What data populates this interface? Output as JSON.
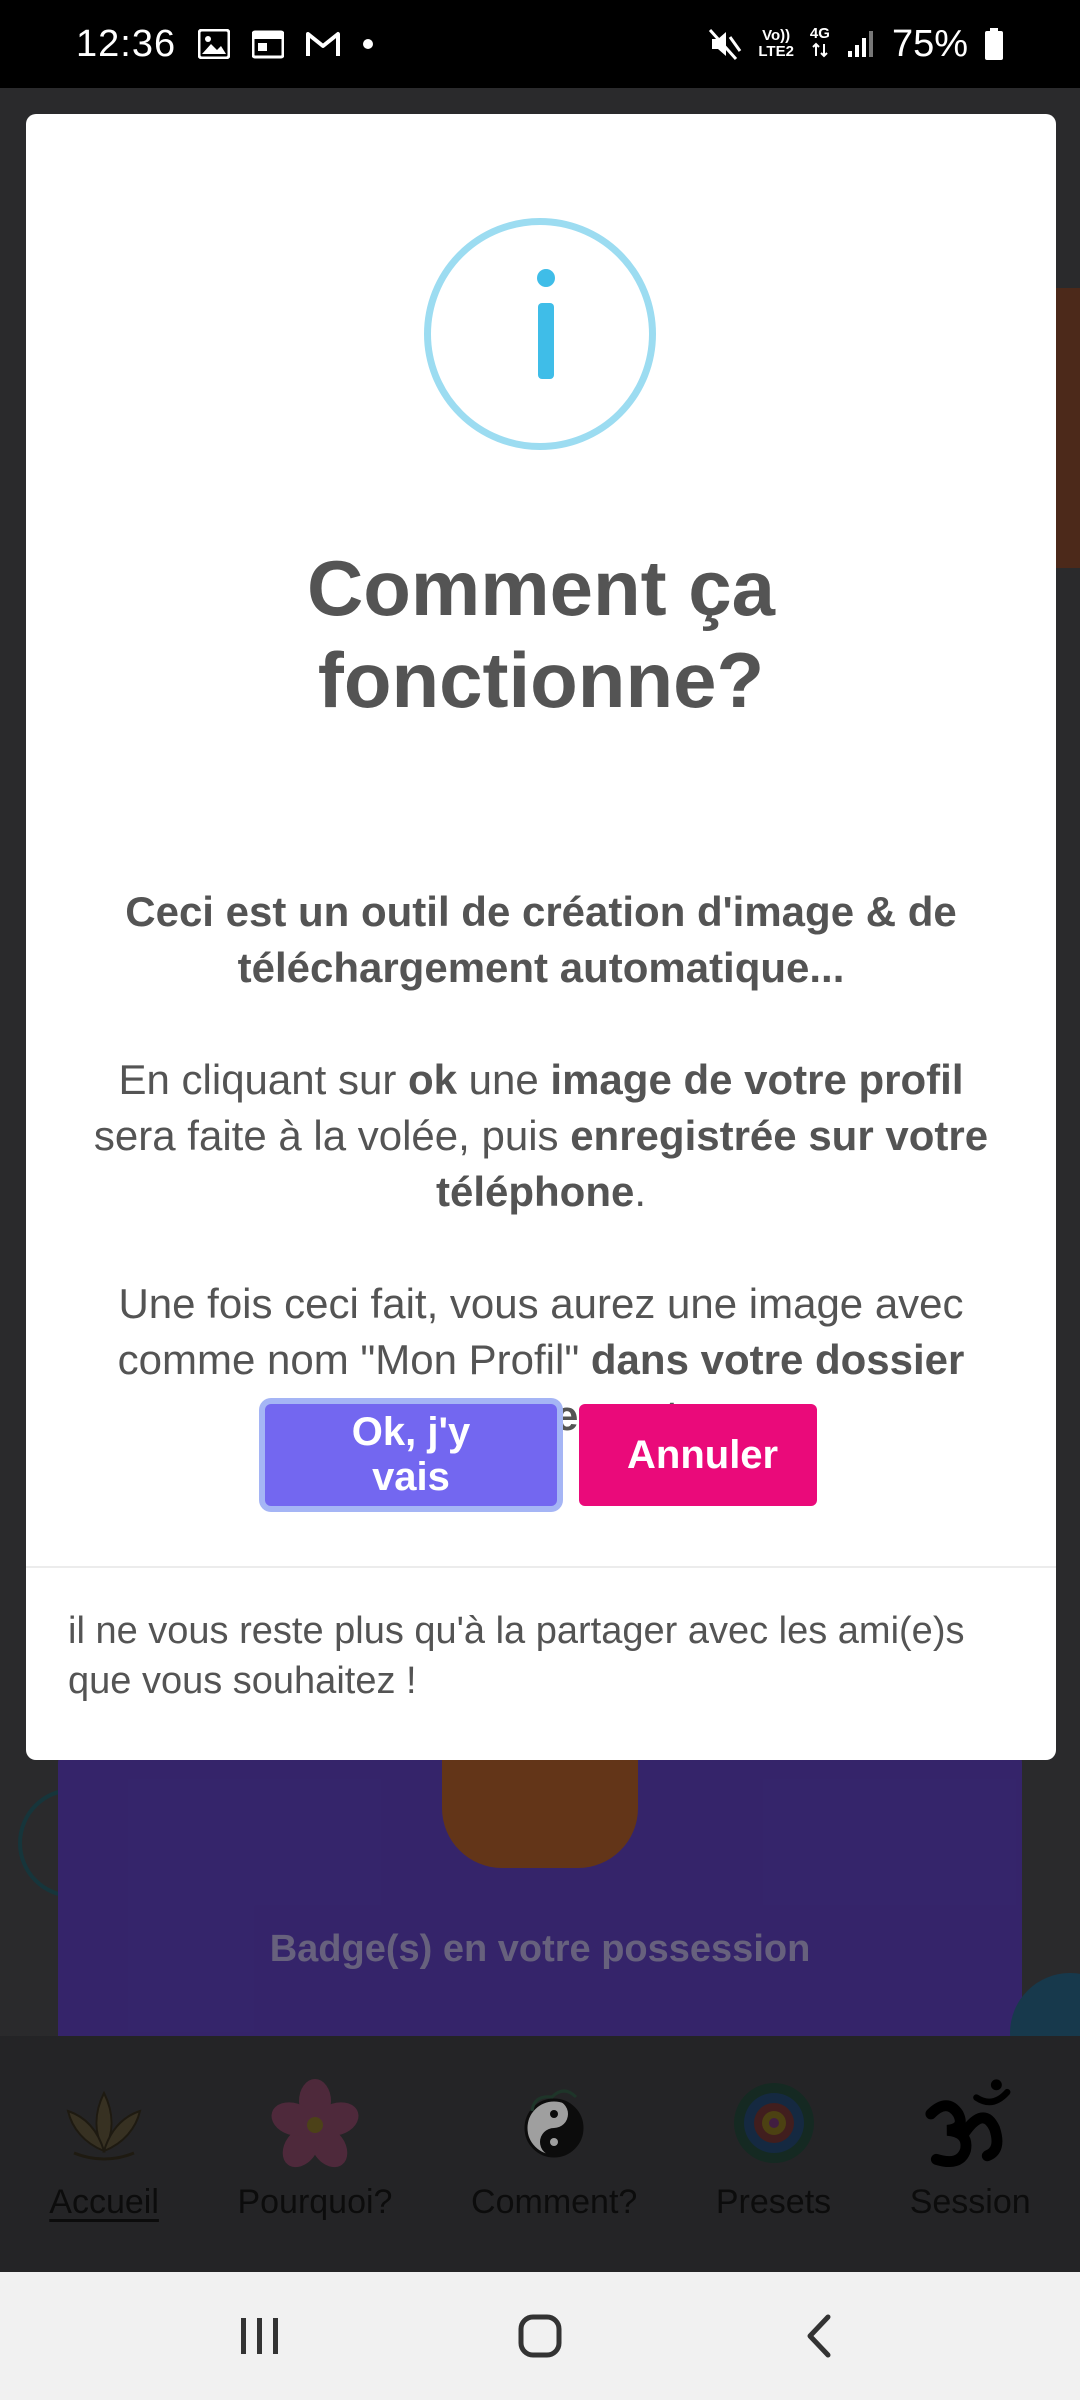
{
  "status_bar": {
    "time": "12:36",
    "network_top": "Vo))",
    "network_bottom": "LTE2",
    "data_type": "4G",
    "battery": "75%"
  },
  "background": {
    "badge_text": "Badge(s) en votre possession"
  },
  "tabs": [
    {
      "label": "Accueil",
      "icon": "lotus-icon",
      "active": true
    },
    {
      "label": "Pourquoi?",
      "icon": "flower-icon",
      "active": false
    },
    {
      "label": "Comment?",
      "icon": "yin-yang-icon",
      "active": false
    },
    {
      "label": "Presets",
      "icon": "mandala-icon",
      "active": false
    },
    {
      "label": "Session",
      "icon": "om-icon",
      "active": false
    }
  ],
  "modal": {
    "title_line1": "Comment ça",
    "title_line2": "fonctionne?",
    "intro": "Ceci est un outil de création d'image & de téléchargement automatique...",
    "p2": {
      "t1": "En cliquant sur ",
      "b1": "ok",
      "t2": " une ",
      "b2": "image de votre profil",
      "t3": " sera faite à la volée, puis ",
      "b3": "enregistrée sur votre téléphone",
      "t4": "."
    },
    "p3": {
      "t1": "Une fois ceci fait, vous aurez une image avec comme nom \"Mon Profil\" ",
      "b1": "dans votre dossier téléchargement",
      "t2": "..."
    },
    "ok_label": "Ok, j'y vais",
    "cancel_label": "Annuler",
    "footer": "il ne vous reste plus qu'à la partager avec les ami(e)s que vous souhaitez !"
  },
  "colors": {
    "ok_button": "#7367f0",
    "cancel_button": "#ea0a7a",
    "info_icon": "#3fbde8",
    "text": "#545454"
  }
}
